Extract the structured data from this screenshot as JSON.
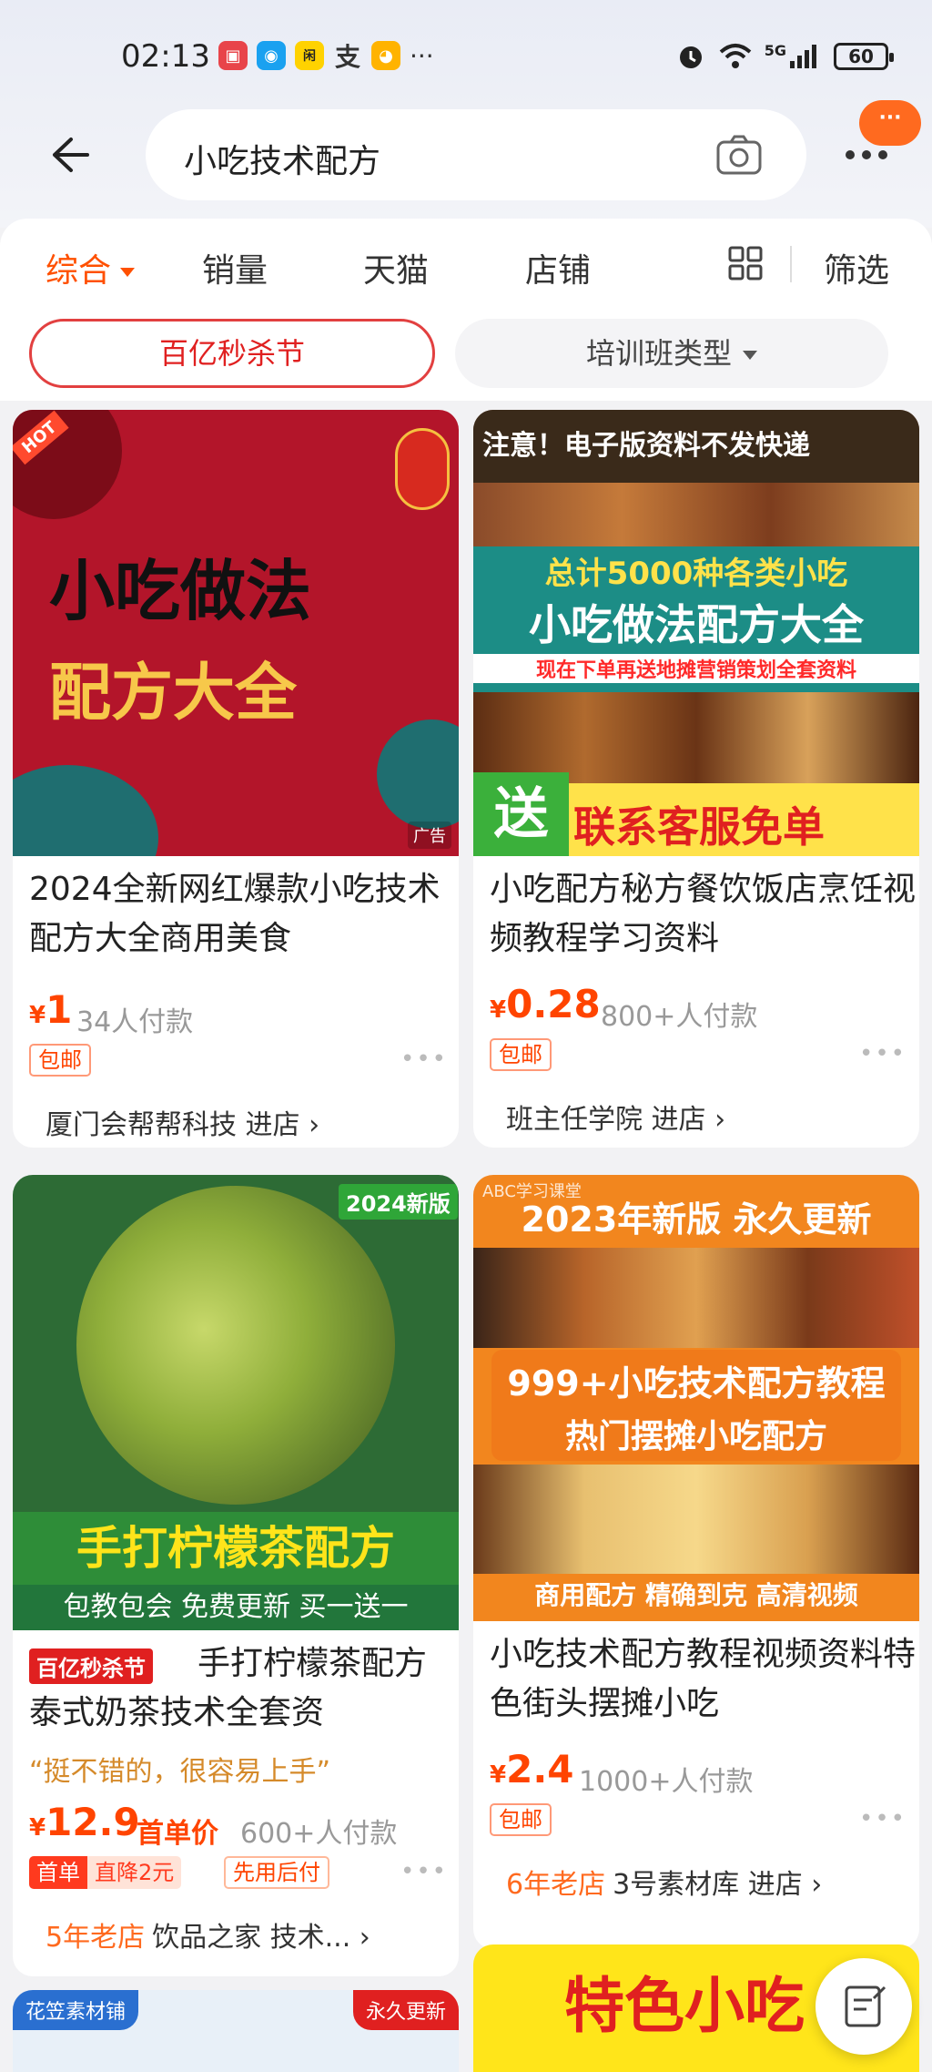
{
  "status_bar": {
    "time": "02:13",
    "more": "···",
    "network": "5G",
    "battery": "60"
  },
  "search": {
    "query": "小吃技术配方",
    "more_badge": "···"
  },
  "filters": {
    "tabs": [
      "综合",
      "销量",
      "天猫",
      "店铺"
    ],
    "filter_label": "筛选"
  },
  "chips": {
    "promo": "百亿秒杀节",
    "category": "培训班类型"
  },
  "products": [
    {
      "image_text": {
        "badge": "HOT",
        "line1": "小吃做法",
        "line2": "配方大全",
        "ad": "广告"
      },
      "title": "2024全新网红爆款小吃技术配方大全商用美食",
      "currency": "¥",
      "price": "1",
      "paid": "34人付款",
      "tag": "包邮",
      "shop": "厦门会帮帮科技",
      "enter": "进店 ›"
    },
    {
      "image_text": {
        "top": "注意！电子版资料不发快递",
        "line1": "总计5000种各类小吃",
        "line2": "小吃做法配方大全",
        "line3": "现在下单再送地摊营销策划全套资料",
        "bottom": "联系客服免单",
        "send": "送"
      },
      "title": "小吃配方秘方餐饮饭店烹饪视频教程学习资料",
      "currency": "¥",
      "price": "0.28",
      "paid": "800+人付款",
      "tag": "包邮",
      "shop": "班主任学院",
      "enter": "进店 ›"
    },
    {
      "image_text": {
        "corner": "2024新版",
        "banner": "手打柠檬茶配方",
        "sub": "包教包会 免费更新 买一送一"
      },
      "promo_tag": "百亿秒杀节",
      "title": "手打柠檬茶配方泰式奶茶技术全套资",
      "review": "“挺不错的，很容易上手”",
      "currency": "¥",
      "price": "12.9",
      "price_note": "首单价",
      "paid": "600+人付款",
      "coupon_a": "首单",
      "coupon_b": "直降2元",
      "tag": "先用后付",
      "shop_age": "5年老店",
      "shop": "饮品之家 技术...",
      "enter": "›"
    },
    {
      "image_text": {
        "watermark": "ABC学习课堂",
        "top": "2023年新版 永久更新",
        "mid1": "999+小吃技术配方教程",
        "mid2": "热门摆摊小吃配方",
        "bottom": "商用配方 精确到克 高清视频"
      },
      "title": "小吃技术配方教程视频资料特色街头摆摊小吃",
      "currency": "¥",
      "price": "2.4",
      "paid": "1000+人付款",
      "tag": "包邮",
      "shop_age": "6年老店",
      "shop": "3号素材库",
      "enter": "进店 ›"
    }
  ],
  "peek": {
    "left_tag": "花笠素材铺",
    "right_tag": "永久更新",
    "right_text": "特色小吃"
  },
  "colors": {
    "accent": "#ff5000",
    "price": "#ff4400"
  }
}
